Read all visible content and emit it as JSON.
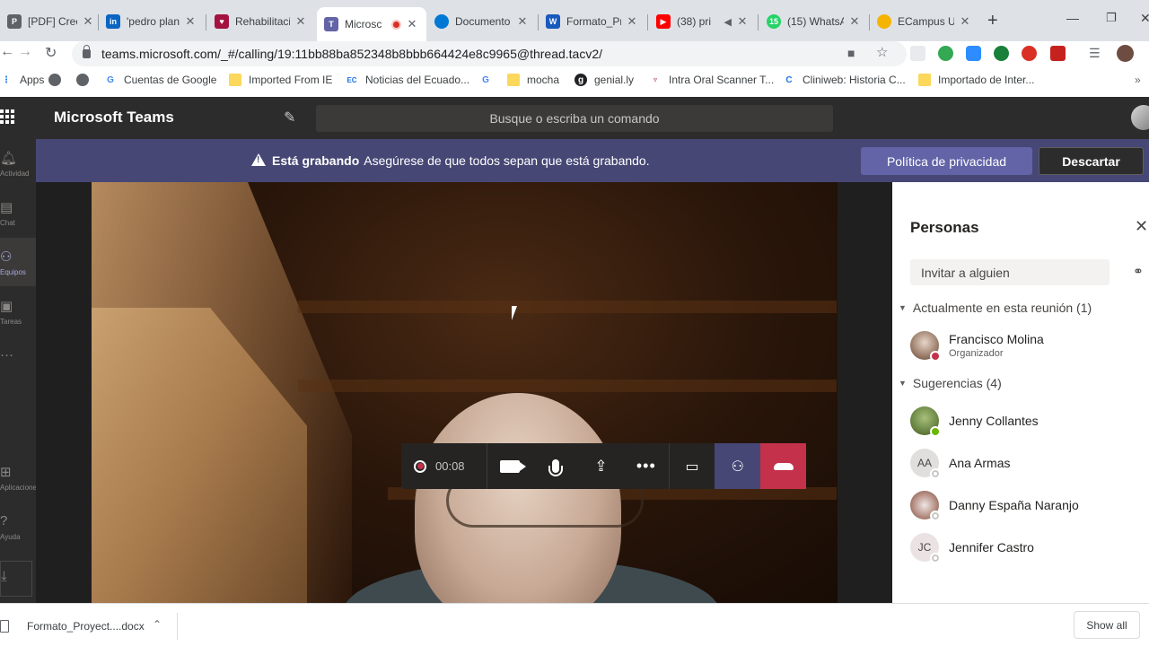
{
  "browser": {
    "tabs": [
      {
        "title": "[PDF] Crecim",
        "icon": "pdf-icon",
        "color": "#5f6368"
      },
      {
        "title": "'pedro plan",
        "icon": "linkedin-icon",
        "color": "#0a66c2"
      },
      {
        "title": "Rehabilitació",
        "icon": "rehab-icon",
        "color": "#a4123f"
      },
      {
        "title": "Microsc",
        "icon": "teams-icon",
        "color": "#6264a7"
      },
      {
        "title": "Documento",
        "icon": "onedrive-icon",
        "color": "#0078d4"
      },
      {
        "title": "Formato_Pr",
        "icon": "word-icon",
        "color": "#185abd"
      },
      {
        "title": "(38) pri",
        "icon": "youtube-icon",
        "color": "#ff0000"
      },
      {
        "title": "(15) WhatsA",
        "icon": "whatsapp-icon",
        "color": "#25d366"
      },
      {
        "title": "ECampus U",
        "icon": "ecampus-icon",
        "color": "#f4b400"
      }
    ],
    "url": "teams.microsoft.com/_#/calling/19:11bb88ba852348b8bbb664424e8c9965@thread.tacv2/",
    "bookmarks": [
      {
        "label": "Apps",
        "icon": "apps-grid-icon"
      },
      {
        "label": "",
        "icon": "globe-icon"
      },
      {
        "label": "",
        "icon": "globe-icon"
      },
      {
        "label": "Cuentas de Google",
        "icon": "google-icon"
      },
      {
        "label": "Imported From IE",
        "icon": "folder-icon"
      },
      {
        "label": "Noticias del Ecuado...",
        "icon": "news-icon"
      },
      {
        "label": "",
        "icon": "google-icon"
      },
      {
        "label": "mocha",
        "icon": "folder-icon"
      },
      {
        "label": "genial.ly",
        "icon": "genially-icon"
      },
      {
        "label": "Intra Oral Scanner T...",
        "icon": "intraoral-icon"
      },
      {
        "label": "Cliniweb: Historia C...",
        "icon": "cliniweb-icon"
      },
      {
        "label": "Importado de Inter...",
        "icon": "folder-icon"
      }
    ]
  },
  "teams": {
    "app_title": "Microsoft Teams",
    "search_placeholder": "Busque o escriba un comando",
    "rail": [
      {
        "label": "Actividad",
        "icon": "bell-icon"
      },
      {
        "label": "Chat",
        "icon": "chat-icon"
      },
      {
        "label": "Equipos",
        "icon": "teams-people-icon"
      },
      {
        "label": "Tareas",
        "icon": "briefcase-icon"
      },
      {
        "label": "",
        "icon": "more-icon"
      },
      {
        "label": "Aplicaciones",
        "icon": "apps-icon"
      },
      {
        "label": "Ayuda",
        "icon": "help-icon"
      },
      {
        "label": "",
        "icon": "download-icon"
      }
    ],
    "banner": {
      "bold": "Está grabando",
      "message": "Asegúrese de que todos sepan que está grabando.",
      "privacy_button": "Política de privacidad",
      "dismiss_button": "Descartar",
      "color": "#464775"
    },
    "call": {
      "timer": "00:08",
      "hangup_color": "#c4314b"
    },
    "people": {
      "title": "Personas",
      "invite_placeholder": "Invitar a alguien",
      "in_meeting_label": "Actualmente en esta reunión (1)",
      "suggestions_label": "Sugerencias (4)",
      "in_meeting": [
        {
          "name": "Francisco Molina",
          "role": "Organizador",
          "status_color": "#c4314b"
        }
      ],
      "suggestions": [
        {
          "name": "Jenny Collantes",
          "initials": "",
          "status_color": "#6bb700"
        },
        {
          "name": "Ana Armas",
          "initials": "AA",
          "status_color": "#c8c6c4"
        },
        {
          "name": "Danny España Naranjo",
          "initials": "",
          "status_color": "#c8c6c4"
        },
        {
          "name": "Jennifer Castro",
          "initials": "JC",
          "status_color": "#c8c6c4"
        }
      ]
    }
  },
  "downloads": {
    "file": "Formato_Proyect....docx",
    "show_all": "Show all"
  }
}
